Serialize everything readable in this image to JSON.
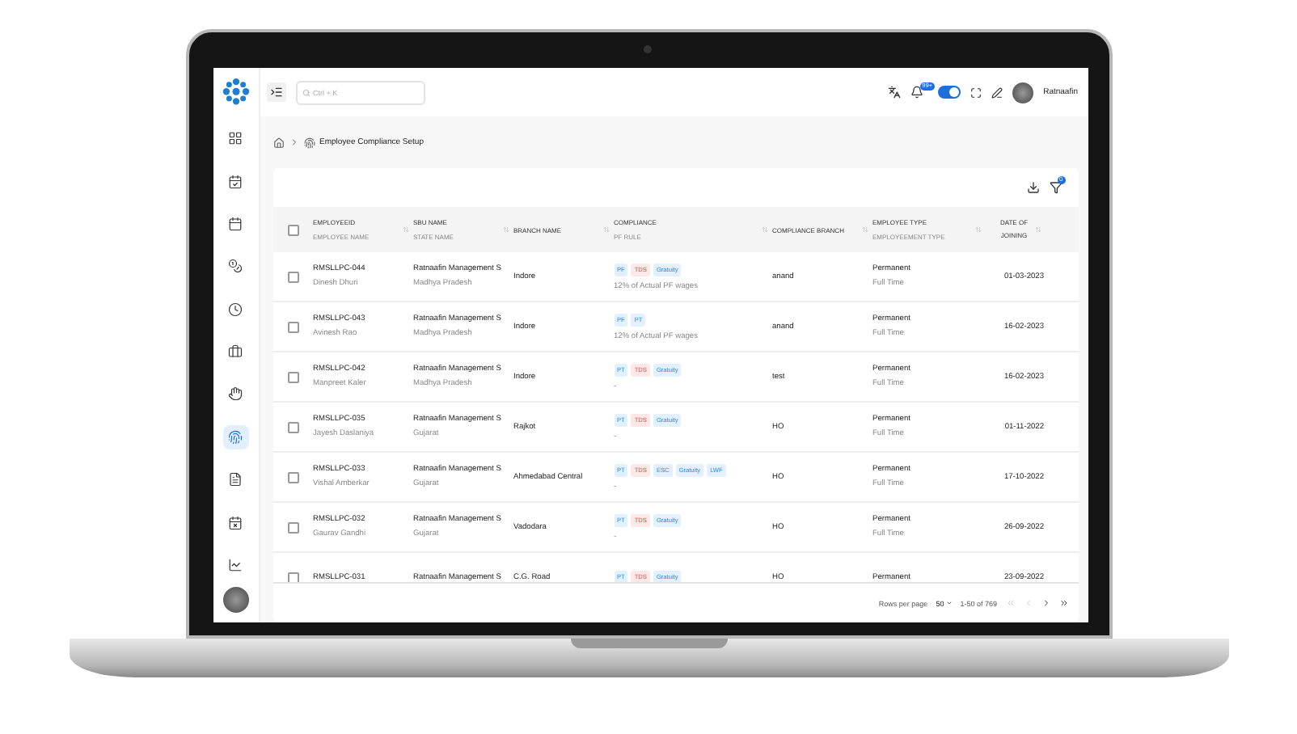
{
  "topbar": {
    "search": {
      "placeholder": "Ctrl + K"
    },
    "notification_badge": "99+",
    "theme_toggle": {
      "on": true
    },
    "user_name": "Ratnaafin"
  },
  "sidebar": {
    "items": [
      {
        "selected": false
      },
      {
        "selected": false
      },
      {
        "selected": false
      },
      {
        "selected": false
      },
      {
        "selected": false
      },
      {
        "selected": false
      },
      {
        "selected": false
      },
      {
        "selected": true
      },
      {
        "selected": false
      },
      {
        "selected": false
      },
      {
        "selected": false
      }
    ]
  },
  "breadcrumb": {
    "title": "Employee Compliance Setup"
  },
  "toolbar": {
    "filter_badge": "0"
  },
  "table": {
    "header_checkbox": {
      "checked": false
    },
    "columns": [
      {
        "title": "EMPLOYEEID",
        "subtitle": "EMPLOYEE NAME"
      },
      {
        "title": "SBU NAME",
        "subtitle": "STATE NAME"
      },
      {
        "title": "BRANCH NAME"
      },
      {
        "title": "COMPLIANCE",
        "subtitle": "PF RULE"
      },
      {
        "title": "COMPLIANCE BRANCH"
      },
      {
        "title": "EMPLOYEE TYPE",
        "subtitle": "EMPLOYEEMENT TYPE"
      },
      {
        "title": "DATE OF JOINING"
      }
    ],
    "rows": [
      {
        "checked": false,
        "employee_id": "RMSLLPC-044",
        "employee_name": "Dinesh Dhuri",
        "sbu": "Ratnaafin Management S",
        "state": "Madhya Pradesh",
        "branch": "Indore",
        "tags": [
          {
            "label": "PF",
            "color": "#e3f0ff"
          },
          {
            "label": "TDS",
            "color": "#fde8e8"
          },
          {
            "label": "Gratuity",
            "color": "#e3f0ff"
          }
        ],
        "pf_rule": "12% of Actual PF wages",
        "compliance_branch": "anand",
        "employee_type": "Permanent",
        "employment_type": "Full Time",
        "joining": "01-03-2023"
      },
      {
        "checked": false,
        "employee_id": "RMSLLPC-043",
        "employee_name": "Avinesh Rao",
        "sbu": "Ratnaafin Management S",
        "state": "Madhya Pradesh",
        "branch": "Indore",
        "tags": [
          {
            "label": "PF",
            "color": "#e3f0ff"
          },
          {
            "label": "PT",
            "color": "#e3f0ff"
          }
        ],
        "pf_rule": "12% of Actual PF wages",
        "compliance_branch": "anand",
        "employee_type": "Permanent",
        "employment_type": "Full Time",
        "joining": "16-02-2023"
      },
      {
        "checked": false,
        "employee_id": "RMSLLPC-042",
        "employee_name": "Manpreet Kaler",
        "sbu": "Ratnaafin Management S",
        "state": "Madhya Pradesh",
        "branch": "Indore",
        "tags": [
          {
            "label": "PT",
            "color": "#e3f0ff"
          },
          {
            "label": "TDS",
            "color": "#fde8e8"
          },
          {
            "label": "Gratuity",
            "color": "#e3f0ff"
          }
        ],
        "pf_rule": "-",
        "compliance_branch": "test",
        "employee_type": "Permanent",
        "employment_type": "Full Time",
        "joining": "16-02-2023"
      },
      {
        "checked": false,
        "employee_id": "RMSLLPC-035",
        "employee_name": "Jayesh Daslaniya",
        "sbu": "Ratnaafin Management S",
        "state": "Gujarat",
        "branch": "Rajkot",
        "tags": [
          {
            "label": "PT",
            "color": "#e3f0ff"
          },
          {
            "label": "TDS",
            "color": "#fde8e8"
          },
          {
            "label": "Gratuity",
            "color": "#e3f0ff"
          }
        ],
        "pf_rule": "-",
        "compliance_branch": "HO",
        "employee_type": "Permanent",
        "employment_type": "Full Time",
        "joining": "01-11-2022"
      },
      {
        "checked": false,
        "employee_id": "RMSLLPC-033",
        "employee_name": "Vishal Amberkar",
        "sbu": "Ratnaafin Management S",
        "state": "Gujarat",
        "branch": "Ahmedabad Central",
        "tags": [
          {
            "label": "PT",
            "color": "#e3f0ff"
          },
          {
            "label": "TDS",
            "color": "#fde8e8"
          },
          {
            "label": "ESC",
            "color": "#e3f0ff"
          },
          {
            "label": "Gratuity",
            "color": "#e3f0ff"
          },
          {
            "label": "LWF",
            "color": "#e3f0ff"
          }
        ],
        "pf_rule": "-",
        "compliance_branch": "HO",
        "employee_type": "Permanent",
        "employment_type": "Full Time",
        "joining": "17-10-2022"
      },
      {
        "checked": false,
        "employee_id": "RMSLLPC-032",
        "employee_name": "Gaurav Gandhi",
        "sbu": "Ratnaafin Management S",
        "state": "Gujarat",
        "branch": "Vadodara",
        "tags": [
          {
            "label": "PT",
            "color": "#e3f0ff"
          },
          {
            "label": "TDS",
            "color": "#fde8e8"
          },
          {
            "label": "Gratuity",
            "color": "#e3f0ff"
          }
        ],
        "pf_rule": "-",
        "compliance_branch": "HO",
        "employee_type": "Permanent",
        "employment_type": "Full Time",
        "joining": "26-09-2022"
      },
      {
        "checked": false,
        "employee_id": "RMSLLPC-031",
        "sbu": "Ratnaafin Management S",
        "branch": "C.G. Road",
        "tags": [
          {
            "label": "PT",
            "color": "#e3f0ff"
          },
          {
            "label": "TDS",
            "color": "#fde8e8"
          },
          {
            "label": "Gratuity",
            "color": "#e3f0ff"
          }
        ],
        "compliance_branch": "HO",
        "employee_type": "Permanent",
        "joining": "23-09-2022"
      }
    ]
  },
  "pagination": {
    "rows_per_page_label": "Rows per page",
    "rows_per_page": "50",
    "range": "1-50 of 769",
    "first": {
      "disabled": true
    },
    "prev": {
      "disabled": true
    },
    "next": {
      "disabled": false
    },
    "last": {
      "disabled": false
    }
  }
}
